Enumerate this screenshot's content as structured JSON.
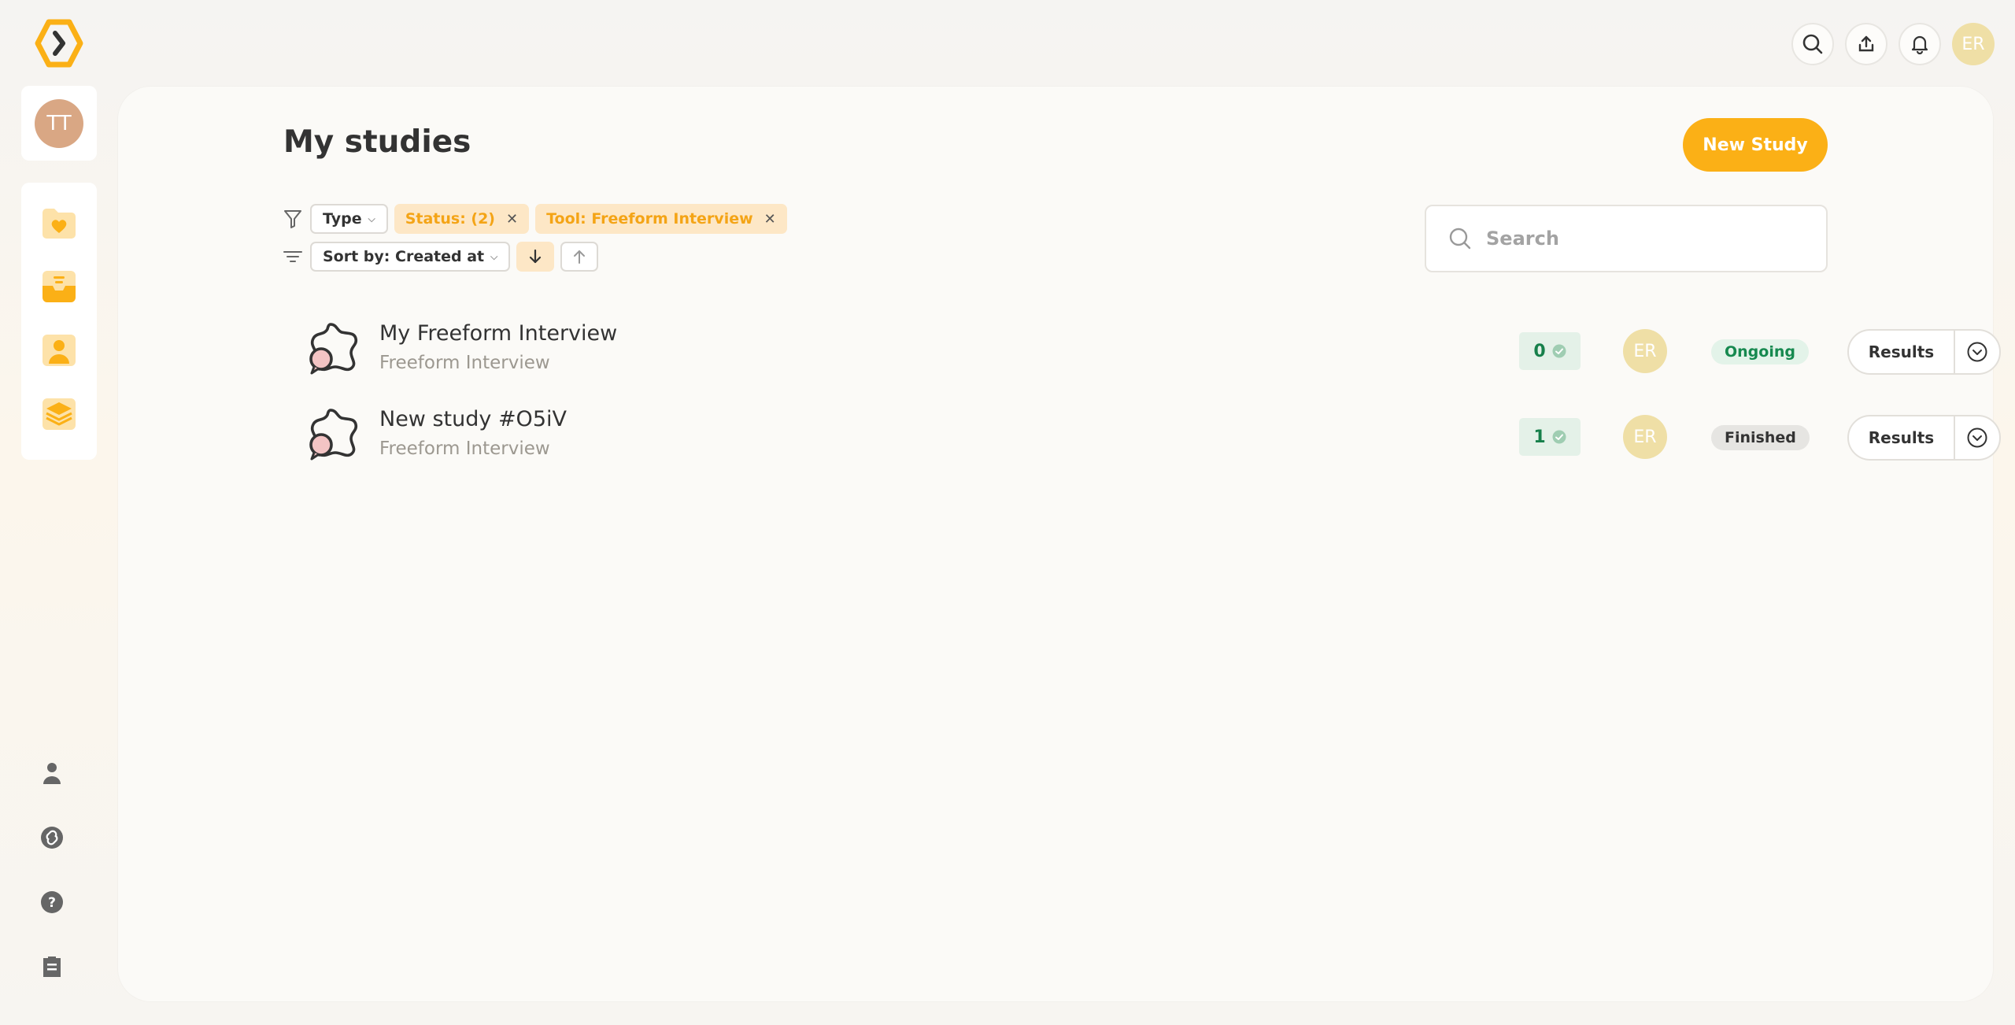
{
  "header": {
    "user_initials": "ER"
  },
  "sidebar": {
    "workspace_initials": "TT"
  },
  "main": {
    "title": "My studies",
    "new_study_label": "New Study",
    "filters": {
      "type_label": "Type",
      "status_label": "Status: (2)",
      "tool_label": "Tool: Freeform Interview"
    },
    "sort": {
      "label": "Sort by: Created at"
    },
    "search": {
      "placeholder": "Search"
    },
    "studies": [
      {
        "name": "My Freeform Interview",
        "type": "Freeform Interview",
        "count": "0",
        "owner_initials": "ER",
        "status": "Ongoing",
        "results_label": "Results"
      },
      {
        "name": "New study #O5iV",
        "type": "Freeform Interview",
        "count": "1",
        "owner_initials": "ER",
        "status": "Finished",
        "results_label": "Results"
      }
    ]
  },
  "colors": {
    "accent": "#fbb016",
    "accent_soft": "#fde7c6",
    "success": "#16894f",
    "avatar": "#efdfa6"
  }
}
